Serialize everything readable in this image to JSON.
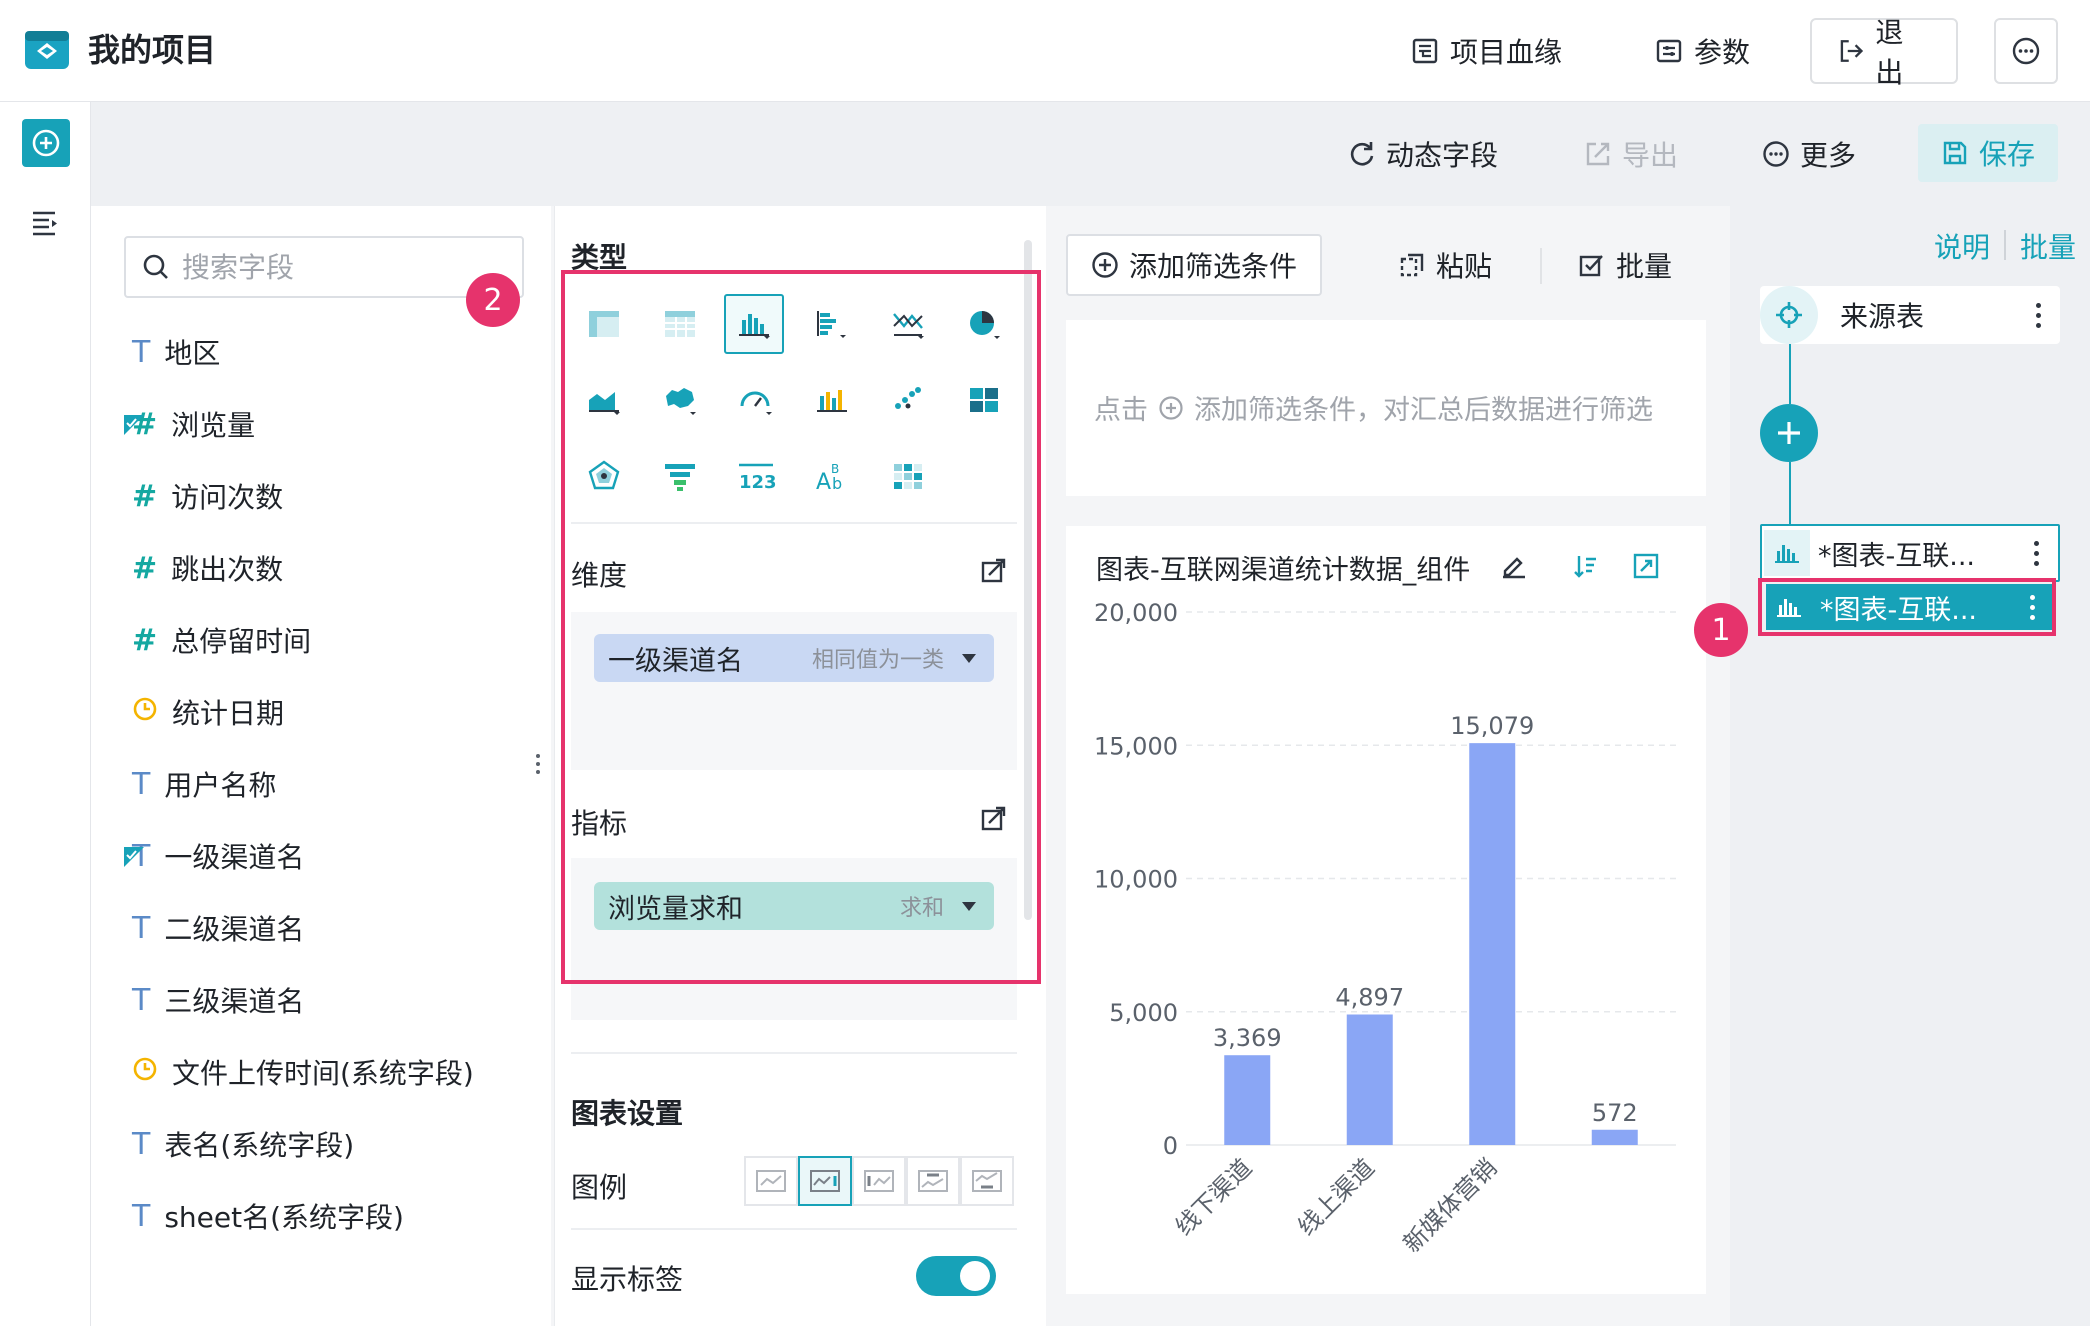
{
  "header": {
    "title": "我的项目",
    "lineage_label": "项目血缘",
    "params_label": "参数",
    "logout_label": "退出"
  },
  "toolbar": {
    "dynamic_field_label": "动态字段",
    "export_label": "导出",
    "more_label": "更多",
    "save_label": "保存"
  },
  "fields": {
    "search_placeholder": "搜索字段",
    "items": [
      {
        "type": "text",
        "label": "地区",
        "marked": false
      },
      {
        "type": "number",
        "label": "浏览量",
        "marked": true
      },
      {
        "type": "number",
        "label": "访问次数",
        "marked": false
      },
      {
        "type": "number",
        "label": "跳出次数",
        "marked": false
      },
      {
        "type": "number",
        "label": "总停留时间",
        "marked": false
      },
      {
        "type": "date",
        "label": "统计日期",
        "marked": false
      },
      {
        "type": "text",
        "label": "用户名称",
        "marked": false
      },
      {
        "type": "text",
        "label": "一级渠道名",
        "marked": true
      },
      {
        "type": "text",
        "label": "二级渠道名",
        "marked": false
      },
      {
        "type": "text",
        "label": "三级渠道名",
        "marked": false
      },
      {
        "type": "date",
        "label": "文件上传时间(系统字段)",
        "marked": false
      },
      {
        "type": "text",
        "label": "表名(系统字段)",
        "marked": false
      },
      {
        "type": "text",
        "label": "sheet名(系统字段)",
        "marked": false
      }
    ]
  },
  "config": {
    "type_label": "类型",
    "dimension_label": "维度",
    "dimension_pill": {
      "label": "一级渠道名",
      "sub": "相同值为一类"
    },
    "metric_label": "指标",
    "metric_pill": {
      "label": "浏览量求和",
      "sub": "求和"
    },
    "chart_settings_label": "图表设置",
    "legend_label": "图例",
    "show_labels_label": "显示标签",
    "show_labels_on": true,
    "selected_chart_type": "bar"
  },
  "filter": {
    "add_label": "添加筛选条件",
    "paste_label": "粘贴",
    "batch_label": "批量",
    "hint_prefix": "点击",
    "hint_text": "添加筛选条件，对汇总后数据进行筛选"
  },
  "chart_card": {
    "title": "图表-互联网渠道统计数据_组件"
  },
  "chart_data": {
    "type": "bar",
    "categories": [
      "线下渠道",
      "线上渠道",
      "新媒体营销",
      ""
    ],
    "values": [
      3369,
      4897,
      15079,
      572
    ],
    "value_labels": [
      "3,369",
      "4,897",
      "15,079",
      "572"
    ],
    "y_ticks": [
      "0",
      "5,000",
      "10,000",
      "15,000",
      "20,000"
    ],
    "ylim": [
      0,
      20000
    ],
    "bar_color": "#8aa6f5",
    "grid": true
  },
  "flow": {
    "desc_label": "说明",
    "batch_label": "批量",
    "source_label": "来源表",
    "chart_node_1": "*图表-互联...",
    "chart_node_2": "*图表-互联..."
  },
  "badges": {
    "one": "1",
    "two": "2"
  },
  "colors": {
    "accent": "#17a2b8",
    "highlight": "#e6336c",
    "bar": "#8aa6f5"
  }
}
